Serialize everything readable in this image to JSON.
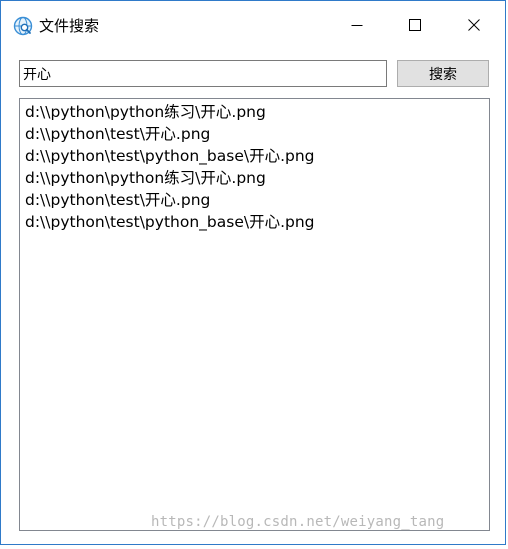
{
  "window": {
    "title": "文件搜索",
    "accent_color": "#2f7ac9",
    "controls": {
      "minimize_icon": "minimize-icon",
      "maximize_icon": "maximize-icon",
      "close_icon": "close-icon"
    },
    "app_icon": "globe-search-icon"
  },
  "search": {
    "value": "开心",
    "button_label": "搜索"
  },
  "results": [
    "d:\\\\python\\python练习\\开心.png",
    "d:\\\\python\\test\\开心.png",
    "d:\\\\python\\test\\python_base\\开心.png",
    "d:\\\\python\\python练习\\开心.png",
    "d:\\\\python\\test\\开心.png",
    "d:\\\\python\\test\\python_base\\开心.png"
  ],
  "watermark": "https://blog.csdn.net/weiyang_tang"
}
